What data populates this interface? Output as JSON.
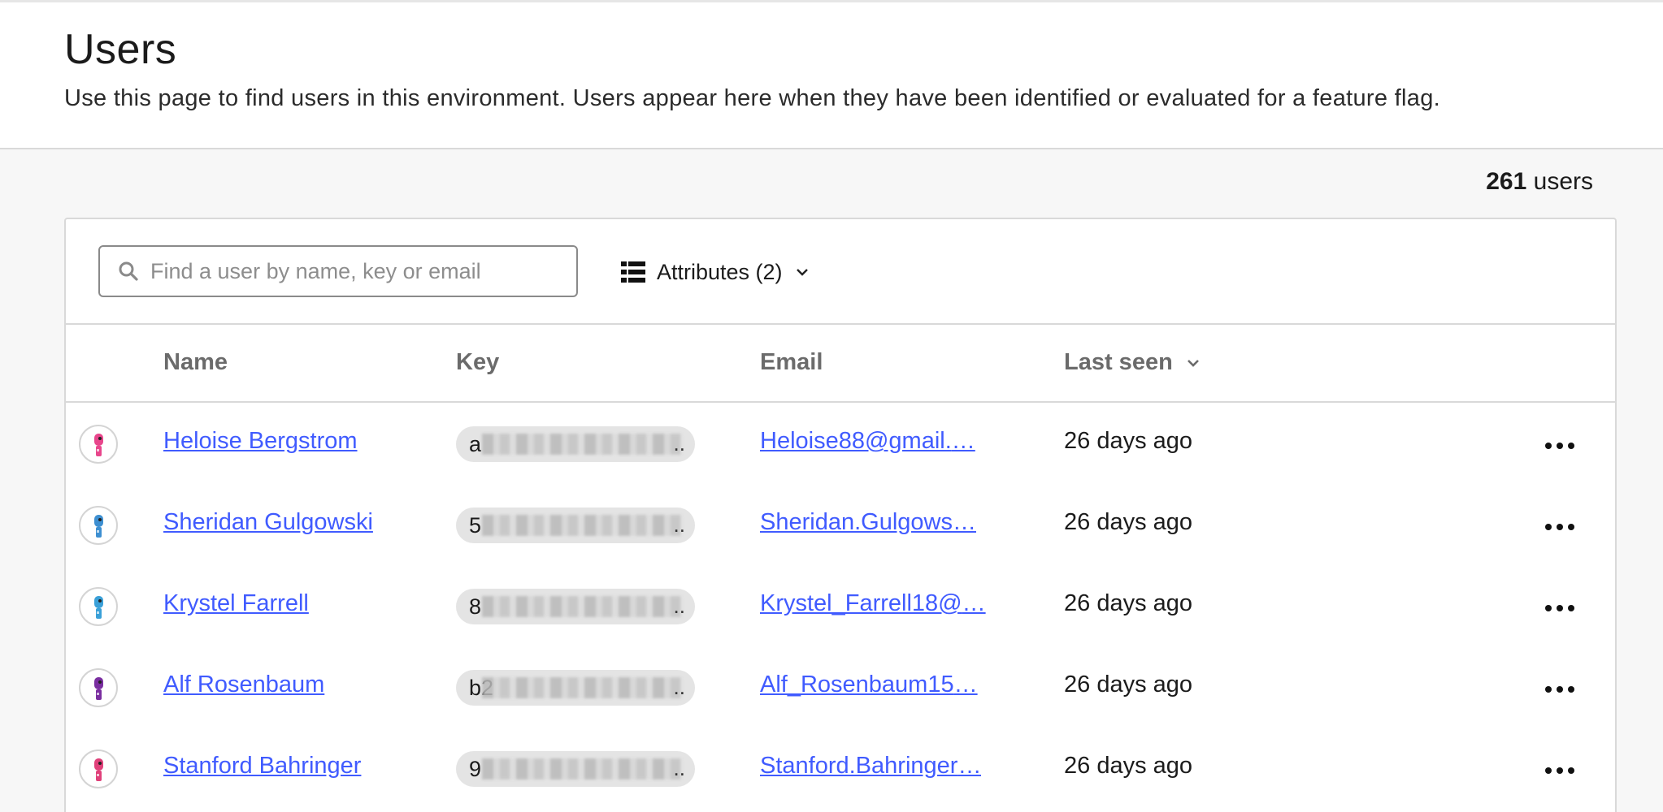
{
  "header": {
    "title": "Users",
    "description": "Use this page to find users in this environment. Users appear here when they have been identified or evaluated for a feature flag."
  },
  "summary": {
    "count": "261",
    "count_label": " users"
  },
  "toolbar": {
    "search_placeholder": "Find a user by name, key or email",
    "search_value": "",
    "attributes_label": "Attributes (2)"
  },
  "table": {
    "columns": [
      "Name",
      "Key",
      "Email",
      "Last seen"
    ],
    "sort_column": "Last seen",
    "rows": [
      {
        "name": "Heloise Bergstrom",
        "key_prefix": "a",
        "email": "Heloise88@gmail.",
        "last_seen": "26 days ago",
        "avatar_color": "#e8468c"
      },
      {
        "name": "Sheridan Gulgowski",
        "key_prefix": "5",
        "email": "Sheridan.Gulgows",
        "last_seen": "26 days ago",
        "avatar_color": "#3d8fd1"
      },
      {
        "name": "Krystel Farrell",
        "key_prefix": "8",
        "email": "Krystel_Farrell18@",
        "last_seen": "26 days ago",
        "avatar_color": "#3aa0d8"
      },
      {
        "name": "Alf Rosenbaum",
        "key_prefix": "b2",
        "email": "Alf_Rosenbaum15",
        "last_seen": "26 days ago",
        "avatar_color": "#7a2ea0"
      },
      {
        "name": "Stanford Bahringer",
        "key_prefix": "9",
        "email": "Stanford.Bahringer",
        "last_seen": "26 days ago",
        "avatar_color": "#e0407a"
      }
    ]
  },
  "icons": {
    "search": "search-icon",
    "attributes": "list-icon",
    "dropdown": "chevron-down-icon",
    "row_menu": "more-horizontal-icon"
  },
  "colors": {
    "link": "#405bff",
    "background": "#f7f7f7",
    "panel": "#ffffff",
    "border": "#d9d9d9"
  }
}
